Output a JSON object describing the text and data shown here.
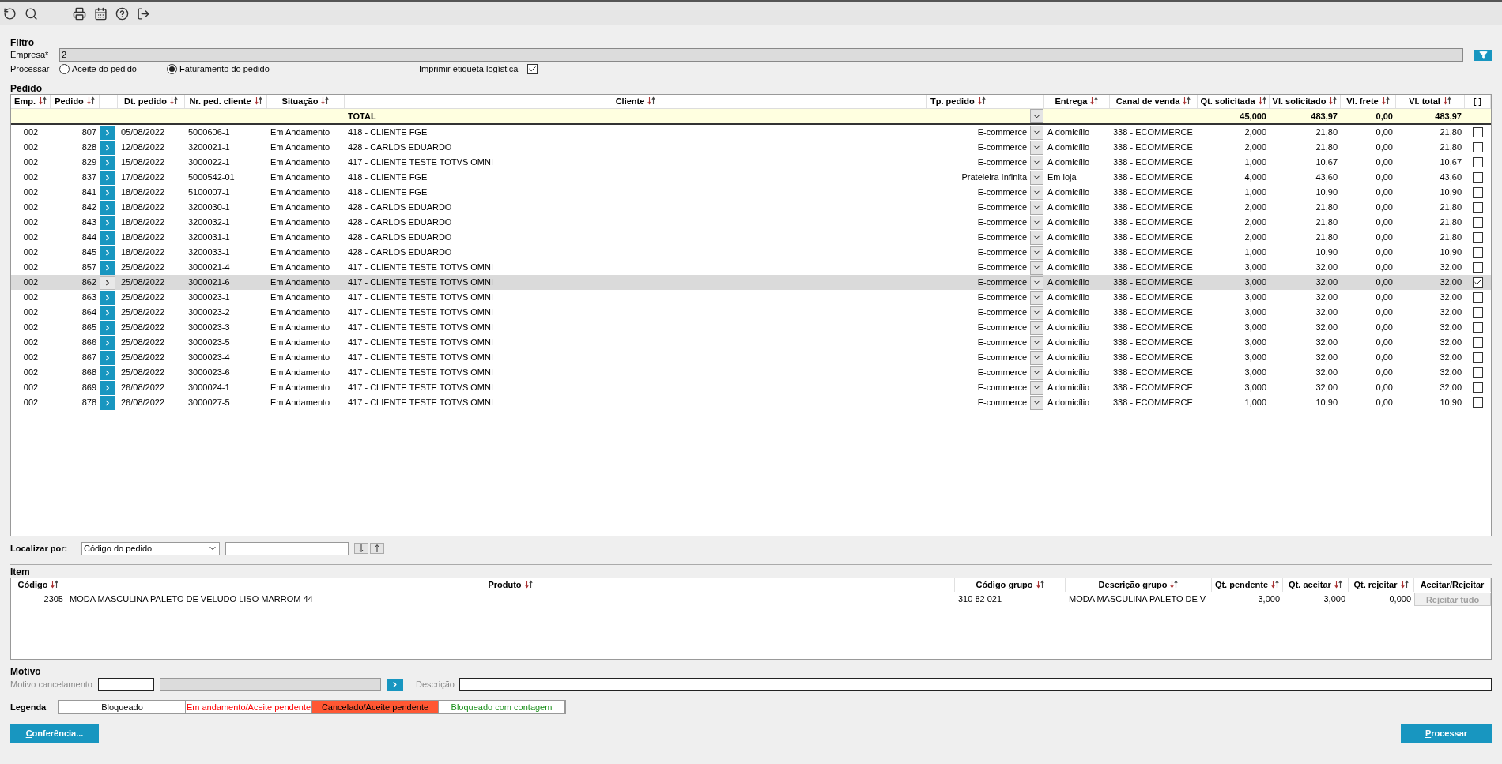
{
  "filter": {
    "title": "Filtro",
    "empresa": {
      "label": "Empresa*",
      "value": "2"
    },
    "processar": {
      "label": "Processar",
      "options": [
        {
          "label": "Aceite do pedido",
          "selected": false
        },
        {
          "label": "Faturamento do pedido",
          "selected": true
        }
      ]
    },
    "etiqueta": {
      "label": "Imprimir etiqueta logística",
      "checked": true
    }
  },
  "pedido": {
    "title": "Pedido",
    "columns": [
      {
        "label": "Emp.",
        "sortable": true
      },
      {
        "label": "Pedido",
        "sortable": true
      },
      {
        "label": "Dt. pedido",
        "sortable": true
      },
      {
        "label": "Nr. ped. cliente",
        "sortable": true
      },
      {
        "label": "Situação",
        "sortable": true
      },
      {
        "label": "Cliente",
        "sortable": true
      },
      {
        "label": "Tp. pedido",
        "sortable": true
      },
      {
        "label": "Entrega",
        "sortable": true
      },
      {
        "label": "Canal de venda",
        "sortable": true
      },
      {
        "label": "Qt. solicitada",
        "sortable": true
      },
      {
        "label": "Vl. solicitado",
        "sortable": true
      },
      {
        "label": "Vl. frete",
        "sortable": true
      },
      {
        "label": "Vl. total",
        "sortable": true
      },
      {
        "label": "[ ]",
        "sortable": false
      }
    ],
    "total": {
      "label": "TOTAL",
      "qt": "45,000",
      "vl_sol": "483,97",
      "frete": "0,00",
      "total": "483,97"
    },
    "rows": [
      {
        "emp": "002",
        "pedido": "807",
        "dt": "05/08/2022",
        "nr": "5000606-1",
        "situacao": "Em Andamento",
        "cliente": "418 - CLIENTE FGE",
        "tp": "E-commerce",
        "entrega": "A domicílio",
        "canal": "338 - ECOMMERCE",
        "qt": "2,000",
        "vl_sol": "21,80",
        "frete": "0,00",
        "total": "21,80",
        "checked": false,
        "selected": false
      },
      {
        "emp": "002",
        "pedido": "828",
        "dt": "12/08/2022",
        "nr": "3200021-1",
        "situacao": "Em Andamento",
        "cliente": "428 - CARLOS EDUARDO",
        "tp": "E-commerce",
        "entrega": "A domicílio",
        "canal": "338 - ECOMMERCE",
        "qt": "2,000",
        "vl_sol": "21,80",
        "frete": "0,00",
        "total": "21,80",
        "checked": false,
        "selected": false
      },
      {
        "emp": "002",
        "pedido": "829",
        "dt": "15/08/2022",
        "nr": "3000022-1",
        "situacao": "Em Andamento",
        "cliente": "417 - CLIENTE TESTE TOTVS OMNI",
        "tp": "E-commerce",
        "entrega": "A domicílio",
        "canal": "338 - ECOMMERCE",
        "qt": "1,000",
        "vl_sol": "10,67",
        "frete": "0,00",
        "total": "10,67",
        "checked": false,
        "selected": false
      },
      {
        "emp": "002",
        "pedido": "837",
        "dt": "17/08/2022",
        "nr": "5000542-01",
        "situacao": "Em Andamento",
        "cliente": "418 - CLIENTE FGE",
        "tp": "Prateleira Infinita",
        "entrega": "Em loja",
        "canal": "338 - ECOMMERCE",
        "qt": "4,000",
        "vl_sol": "43,60",
        "frete": "0,00",
        "total": "43,60",
        "checked": false,
        "selected": false
      },
      {
        "emp": "002",
        "pedido": "841",
        "dt": "18/08/2022",
        "nr": "5100007-1",
        "situacao": "Em Andamento",
        "cliente": "418 - CLIENTE FGE",
        "tp": "E-commerce",
        "entrega": "A domicílio",
        "canal": "338 - ECOMMERCE",
        "qt": "1,000",
        "vl_sol": "10,90",
        "frete": "0,00",
        "total": "10,90",
        "checked": false,
        "selected": false
      },
      {
        "emp": "002",
        "pedido": "842",
        "dt": "18/08/2022",
        "nr": "3200030-1",
        "situacao": "Em Andamento",
        "cliente": "428 - CARLOS EDUARDO",
        "tp": "E-commerce",
        "entrega": "A domicílio",
        "canal": "338 - ECOMMERCE",
        "qt": "2,000",
        "vl_sol": "21,80",
        "frete": "0,00",
        "total": "21,80",
        "checked": false,
        "selected": false
      },
      {
        "emp": "002",
        "pedido": "843",
        "dt": "18/08/2022",
        "nr": "3200032-1",
        "situacao": "Em Andamento",
        "cliente": "428 - CARLOS EDUARDO",
        "tp": "E-commerce",
        "entrega": "A domicílio",
        "canal": "338 - ECOMMERCE",
        "qt": "2,000",
        "vl_sol": "21,80",
        "frete": "0,00",
        "total": "21,80",
        "checked": false,
        "selected": false
      },
      {
        "emp": "002",
        "pedido": "844",
        "dt": "18/08/2022",
        "nr": "3200031-1",
        "situacao": "Em Andamento",
        "cliente": "428 - CARLOS EDUARDO",
        "tp": "E-commerce",
        "entrega": "A domicílio",
        "canal": "338 - ECOMMERCE",
        "qt": "2,000",
        "vl_sol": "21,80",
        "frete": "0,00",
        "total": "21,80",
        "checked": false,
        "selected": false
      },
      {
        "emp": "002",
        "pedido": "845",
        "dt": "18/08/2022",
        "nr": "3200033-1",
        "situacao": "Em Andamento",
        "cliente": "428 - CARLOS EDUARDO",
        "tp": "E-commerce",
        "entrega": "A domicílio",
        "canal": "338 - ECOMMERCE",
        "qt": "1,000",
        "vl_sol": "10,90",
        "frete": "0,00",
        "total": "10,90",
        "checked": false,
        "selected": false
      },
      {
        "emp": "002",
        "pedido": "857",
        "dt": "25/08/2022",
        "nr": "3000021-4",
        "situacao": "Em Andamento",
        "cliente": "417 - CLIENTE TESTE TOTVS OMNI",
        "tp": "E-commerce",
        "entrega": "A domicílio",
        "canal": "338 - ECOMMERCE",
        "qt": "3,000",
        "vl_sol": "32,00",
        "frete": "0,00",
        "total": "32,00",
        "checked": false,
        "selected": false
      },
      {
        "emp": "002",
        "pedido": "862",
        "dt": "25/08/2022",
        "nr": "3000021-6",
        "situacao": "Em Andamento",
        "cliente": "417 - CLIENTE TESTE TOTVS OMNI",
        "tp": "E-commerce",
        "entrega": "A domicílio",
        "canal": "338 - ECOMMERCE",
        "qt": "3,000",
        "vl_sol": "32,00",
        "frete": "0,00",
        "total": "32,00",
        "checked": true,
        "selected": true
      },
      {
        "emp": "002",
        "pedido": "863",
        "dt": "25/08/2022",
        "nr": "3000023-1",
        "situacao": "Em Andamento",
        "cliente": "417 - CLIENTE TESTE TOTVS OMNI",
        "tp": "E-commerce",
        "entrega": "A domicílio",
        "canal": "338 - ECOMMERCE",
        "qt": "3,000",
        "vl_sol": "32,00",
        "frete": "0,00",
        "total": "32,00",
        "checked": false,
        "selected": false
      },
      {
        "emp": "002",
        "pedido": "864",
        "dt": "25/08/2022",
        "nr": "3000023-2",
        "situacao": "Em Andamento",
        "cliente": "417 - CLIENTE TESTE TOTVS OMNI",
        "tp": "E-commerce",
        "entrega": "A domicílio",
        "canal": "338 - ECOMMERCE",
        "qt": "3,000",
        "vl_sol": "32,00",
        "frete": "0,00",
        "total": "32,00",
        "checked": false,
        "selected": false
      },
      {
        "emp": "002",
        "pedido": "865",
        "dt": "25/08/2022",
        "nr": "3000023-3",
        "situacao": "Em Andamento",
        "cliente": "417 - CLIENTE TESTE TOTVS OMNI",
        "tp": "E-commerce",
        "entrega": "A domicílio",
        "canal": "338 - ECOMMERCE",
        "qt": "3,000",
        "vl_sol": "32,00",
        "frete": "0,00",
        "total": "32,00",
        "checked": false,
        "selected": false
      },
      {
        "emp": "002",
        "pedido": "866",
        "dt": "25/08/2022",
        "nr": "3000023-5",
        "situacao": "Em Andamento",
        "cliente": "417 - CLIENTE TESTE TOTVS OMNI",
        "tp": "E-commerce",
        "entrega": "A domicílio",
        "canal": "338 - ECOMMERCE",
        "qt": "3,000",
        "vl_sol": "32,00",
        "frete": "0,00",
        "total": "32,00",
        "checked": false,
        "selected": false
      },
      {
        "emp": "002",
        "pedido": "867",
        "dt": "25/08/2022",
        "nr": "3000023-4",
        "situacao": "Em Andamento",
        "cliente": "417 - CLIENTE TESTE TOTVS OMNI",
        "tp": "E-commerce",
        "entrega": "A domicílio",
        "canal": "338 - ECOMMERCE",
        "qt": "3,000",
        "vl_sol": "32,00",
        "frete": "0,00",
        "total": "32,00",
        "checked": false,
        "selected": false
      },
      {
        "emp": "002",
        "pedido": "868",
        "dt": "25/08/2022",
        "nr": "3000023-6",
        "situacao": "Em Andamento",
        "cliente": "417 - CLIENTE TESTE TOTVS OMNI",
        "tp": "E-commerce",
        "entrega": "A domicílio",
        "canal": "338 - ECOMMERCE",
        "qt": "3,000",
        "vl_sol": "32,00",
        "frete": "0,00",
        "total": "32,00",
        "checked": false,
        "selected": false
      },
      {
        "emp": "002",
        "pedido": "869",
        "dt": "26/08/2022",
        "nr": "3000024-1",
        "situacao": "Em Andamento",
        "cliente": "417 - CLIENTE TESTE TOTVS OMNI",
        "tp": "E-commerce",
        "entrega": "A domicílio",
        "canal": "338 - ECOMMERCE",
        "qt": "3,000",
        "vl_sol": "32,00",
        "frete": "0,00",
        "total": "32,00",
        "checked": false,
        "selected": false
      },
      {
        "emp": "002",
        "pedido": "878",
        "dt": "26/08/2022",
        "nr": "3000027-5",
        "situacao": "Em Andamento",
        "cliente": "417 - CLIENTE TESTE TOTVS OMNI",
        "tp": "E-commerce",
        "entrega": "A domicílio",
        "canal": "338 - ECOMMERCE",
        "qt": "1,000",
        "vl_sol": "10,90",
        "frete": "0,00",
        "total": "10,90",
        "checked": false,
        "selected": false
      }
    ]
  },
  "localizar": {
    "label": "Localizar por:",
    "select": "Código do pedido"
  },
  "item": {
    "title": "Item",
    "columns": [
      {
        "label": "Código",
        "sortable": true
      },
      {
        "label": "Produto",
        "sortable": true
      },
      {
        "label": "Código grupo",
        "sortable": true
      },
      {
        "label": "Descrição grupo",
        "sortable": true
      },
      {
        "label": "Qt. pendente",
        "sortable": true
      },
      {
        "label": "Qt. aceitar",
        "sortable": true
      },
      {
        "label": "Qt. rejeitar",
        "sortable": true
      },
      {
        "label": "Aceitar/Rejeitar",
        "sortable": false
      }
    ],
    "rows": [
      {
        "codigo": "2305",
        "produto": "MODA MASCULINA PALETO DE VELUDO LISO MARROM 44",
        "grupo": "310 82 021",
        "descricao": "MODA MASCULINA PALETO DE V",
        "pendente": "3,000",
        "aceitar": "3,000",
        "rejeitar": "0,000",
        "action": "Rejeitar tudo",
        "action_disabled": true
      }
    ]
  },
  "motivo": {
    "title": "Motivo",
    "cancelamento_label": "Motivo cancelamento",
    "descricao_label": "Descrição"
  },
  "legenda": {
    "title": "Legenda",
    "items": [
      {
        "label": "Bloqueado",
        "kind": "blocked"
      },
      {
        "label": "Em andamento/Aceite pendente",
        "kind": "progress"
      },
      {
        "label": "Cancelado/Aceite pendente",
        "kind": "cancelled"
      },
      {
        "label": "Bloqueado com contagem",
        "kind": "counted"
      }
    ]
  },
  "buttons": {
    "conferencia": "Conferência...",
    "processar": "Processar"
  }
}
